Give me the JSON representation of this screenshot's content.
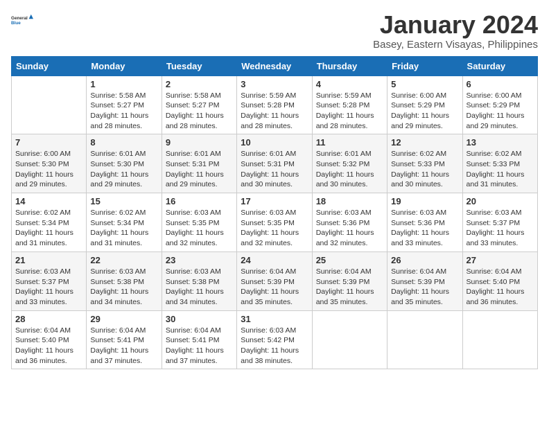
{
  "logo": {
    "line1": "General",
    "line2": "Blue"
  },
  "title": "January 2024",
  "subtitle": "Basey, Eastern Visayas, Philippines",
  "days_of_week": [
    "Sunday",
    "Monday",
    "Tuesday",
    "Wednesday",
    "Thursday",
    "Friday",
    "Saturday"
  ],
  "weeks": [
    [
      {
        "num": "",
        "info": ""
      },
      {
        "num": "1",
        "info": "Sunrise: 5:58 AM\nSunset: 5:27 PM\nDaylight: 11 hours\nand 28 minutes."
      },
      {
        "num": "2",
        "info": "Sunrise: 5:58 AM\nSunset: 5:27 PM\nDaylight: 11 hours\nand 28 minutes."
      },
      {
        "num": "3",
        "info": "Sunrise: 5:59 AM\nSunset: 5:28 PM\nDaylight: 11 hours\nand 28 minutes."
      },
      {
        "num": "4",
        "info": "Sunrise: 5:59 AM\nSunset: 5:28 PM\nDaylight: 11 hours\nand 28 minutes."
      },
      {
        "num": "5",
        "info": "Sunrise: 6:00 AM\nSunset: 5:29 PM\nDaylight: 11 hours\nand 29 minutes."
      },
      {
        "num": "6",
        "info": "Sunrise: 6:00 AM\nSunset: 5:29 PM\nDaylight: 11 hours\nand 29 minutes."
      }
    ],
    [
      {
        "num": "7",
        "info": "Sunrise: 6:00 AM\nSunset: 5:30 PM\nDaylight: 11 hours\nand 29 minutes."
      },
      {
        "num": "8",
        "info": "Sunrise: 6:01 AM\nSunset: 5:30 PM\nDaylight: 11 hours\nand 29 minutes."
      },
      {
        "num": "9",
        "info": "Sunrise: 6:01 AM\nSunset: 5:31 PM\nDaylight: 11 hours\nand 29 minutes."
      },
      {
        "num": "10",
        "info": "Sunrise: 6:01 AM\nSunset: 5:31 PM\nDaylight: 11 hours\nand 30 minutes."
      },
      {
        "num": "11",
        "info": "Sunrise: 6:01 AM\nSunset: 5:32 PM\nDaylight: 11 hours\nand 30 minutes."
      },
      {
        "num": "12",
        "info": "Sunrise: 6:02 AM\nSunset: 5:33 PM\nDaylight: 11 hours\nand 30 minutes."
      },
      {
        "num": "13",
        "info": "Sunrise: 6:02 AM\nSunset: 5:33 PM\nDaylight: 11 hours\nand 31 minutes."
      }
    ],
    [
      {
        "num": "14",
        "info": "Sunrise: 6:02 AM\nSunset: 5:34 PM\nDaylight: 11 hours\nand 31 minutes."
      },
      {
        "num": "15",
        "info": "Sunrise: 6:02 AM\nSunset: 5:34 PM\nDaylight: 11 hours\nand 31 minutes."
      },
      {
        "num": "16",
        "info": "Sunrise: 6:03 AM\nSunset: 5:35 PM\nDaylight: 11 hours\nand 32 minutes."
      },
      {
        "num": "17",
        "info": "Sunrise: 6:03 AM\nSunset: 5:35 PM\nDaylight: 11 hours\nand 32 minutes."
      },
      {
        "num": "18",
        "info": "Sunrise: 6:03 AM\nSunset: 5:36 PM\nDaylight: 11 hours\nand 32 minutes."
      },
      {
        "num": "19",
        "info": "Sunrise: 6:03 AM\nSunset: 5:36 PM\nDaylight: 11 hours\nand 33 minutes."
      },
      {
        "num": "20",
        "info": "Sunrise: 6:03 AM\nSunset: 5:37 PM\nDaylight: 11 hours\nand 33 minutes."
      }
    ],
    [
      {
        "num": "21",
        "info": "Sunrise: 6:03 AM\nSunset: 5:37 PM\nDaylight: 11 hours\nand 33 minutes."
      },
      {
        "num": "22",
        "info": "Sunrise: 6:03 AM\nSunset: 5:38 PM\nDaylight: 11 hours\nand 34 minutes."
      },
      {
        "num": "23",
        "info": "Sunrise: 6:03 AM\nSunset: 5:38 PM\nDaylight: 11 hours\nand 34 minutes."
      },
      {
        "num": "24",
        "info": "Sunrise: 6:04 AM\nSunset: 5:39 PM\nDaylight: 11 hours\nand 35 minutes."
      },
      {
        "num": "25",
        "info": "Sunrise: 6:04 AM\nSunset: 5:39 PM\nDaylight: 11 hours\nand 35 minutes."
      },
      {
        "num": "26",
        "info": "Sunrise: 6:04 AM\nSunset: 5:39 PM\nDaylight: 11 hours\nand 35 minutes."
      },
      {
        "num": "27",
        "info": "Sunrise: 6:04 AM\nSunset: 5:40 PM\nDaylight: 11 hours\nand 36 minutes."
      }
    ],
    [
      {
        "num": "28",
        "info": "Sunrise: 6:04 AM\nSunset: 5:40 PM\nDaylight: 11 hours\nand 36 minutes."
      },
      {
        "num": "29",
        "info": "Sunrise: 6:04 AM\nSunset: 5:41 PM\nDaylight: 11 hours\nand 37 minutes."
      },
      {
        "num": "30",
        "info": "Sunrise: 6:04 AM\nSunset: 5:41 PM\nDaylight: 11 hours\nand 37 minutes."
      },
      {
        "num": "31",
        "info": "Sunrise: 6:03 AM\nSunset: 5:42 PM\nDaylight: 11 hours\nand 38 minutes."
      },
      {
        "num": "",
        "info": ""
      },
      {
        "num": "",
        "info": ""
      },
      {
        "num": "",
        "info": ""
      }
    ]
  ]
}
